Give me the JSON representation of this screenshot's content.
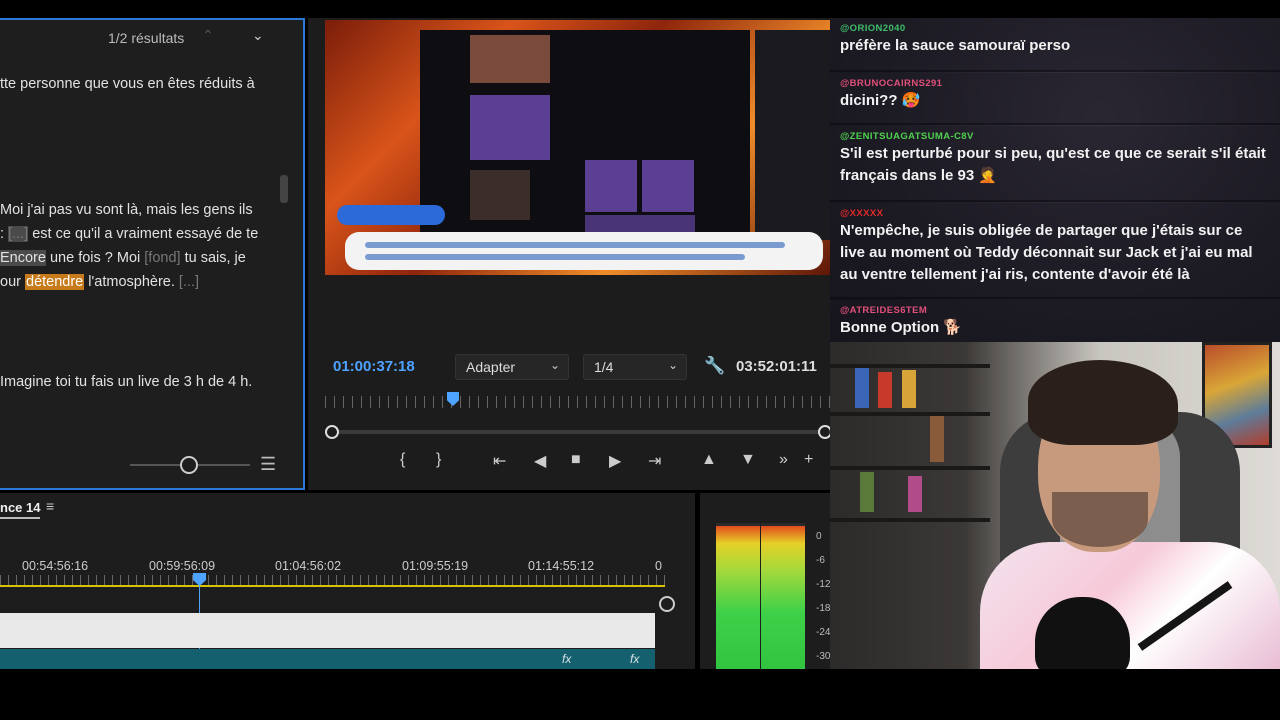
{
  "transcript": {
    "results": "1/2 résultats",
    "line1": "tte personne que vous en êtes réduits à",
    "line2": "Moi j'ai pas vu sont là, mais les gens ils",
    "line3_pre": ": ",
    "line3_ellipsis": "[...]",
    "line3_post": " est ce qu'il a vraiment essayé de te",
    "line4_hl": "Encore",
    "line4_post": " une fois ? Moi ",
    "line4_fond": "[fond]",
    "line4_end": " tu sais, je",
    "line5_pre": "our ",
    "line5_hl": "détendre",
    "line5_post": " l'atmosphère. ",
    "line5_ellipsis": "[...]",
    "line6": "Imagine toi tu fais un live de 3 h de 4 h."
  },
  "monitor": {
    "current_timecode": "01:00:37:18",
    "fit_label": "Adapter",
    "quality_label": "1/4",
    "duration_timecode": "03:52:01:11"
  },
  "timeline": {
    "sequence_name": "nce 14",
    "timecodes": [
      "00:54:56:16",
      "00:59:56:09",
      "01:04:56:02",
      "01:09:55:19",
      "01:14:55:12",
      "0"
    ]
  },
  "meter": {
    "db_labels": [
      "0",
      "-6",
      "-12",
      "-18",
      "-24",
      "-30"
    ]
  },
  "chat": {
    "messages": [
      {
        "user": "@ORION2040",
        "color": "#3fbf6a",
        "text": "préfère la sauce samouraï perso"
      },
      {
        "user": "@BRUNOCAIRNS291",
        "color": "#e0507a",
        "text": "dicini?? 🥵"
      },
      {
        "user": "@ZENITSUAGATSUMA-C8V",
        "color": "#4fd24f",
        "text": "S'il est perturbé pour si peu, qu'est ce que ce serait s'il était français dans le 93 🤦"
      },
      {
        "user": "@XXXXX",
        "color": "#e02a2a",
        "text": "N'empêche, je suis obligée de partager que j'étais sur ce live au moment où Teddy déconnait sur Jack et j'ai eu mal au ventre tellement j'ai ris, contente d'avoir été là"
      },
      {
        "user": "@ATREIDES6TEM",
        "color": "#e0507a",
        "text": "Bonne Option 🐕"
      }
    ]
  }
}
